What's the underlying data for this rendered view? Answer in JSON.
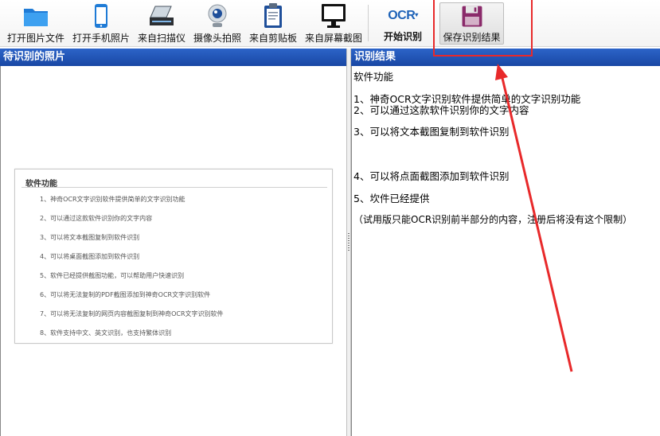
{
  "toolbar": {
    "buttons": [
      {
        "label": "打开图片文件",
        "icon": "folder-icon"
      },
      {
        "label": "打开手机照片",
        "icon": "phone-icon"
      },
      {
        "label": "来自扫描仪",
        "icon": "scanner-icon"
      },
      {
        "label": "摄像头拍照",
        "icon": "webcam-icon"
      },
      {
        "label": "来自剪贴板",
        "icon": "clipboard-icon"
      },
      {
        "label": "来自屏幕截图",
        "icon": "monitor-icon"
      }
    ],
    "ocr_logo": "OCR",
    "start_label": "开始识别",
    "save_label": "保存识别结果",
    "save_icon": "floppy-disk-icon"
  },
  "left_panel": {
    "title": "待识别的照片",
    "card": {
      "title": "软件功能",
      "items": [
        "1、神奇OCR文字识别软件提供简单的文字识别功能",
        "2、可以通过这款软件识别你的文字内容",
        "3、可以将文本截图复制到软件识别",
        "4、可以将桌面截图添加到软件识别",
        "5、软件已经提供截图功能，可以帮助用户快速识别",
        "6、可以将无法复制的PDF截图添加到神奇OCR文字识别软件",
        "7、可以将无法复制的网页内容截图复制到神奇OCR文字识别软件",
        "8、软件支持中文、英文识别，也支持繁体识别"
      ]
    }
  },
  "right_panel": {
    "title": "识别结果",
    "lines": [
      "软件功能",
      "1、神奇OCR文字识别软件提供简单的文字识别功能",
      "2、可以通过这款软件识别你的文字内容",
      "3、可以将文本截图复制到软件识别",
      "4、可以将点面截图添加到软件识别",
      "5、坎件已经提供",
      "（试用版只能OCR识别前半部分的内容，注册后将没有这个限制）"
    ]
  },
  "colors": {
    "header_bg": "#1f4fb0",
    "annotation": "#e8292a",
    "ocr_blue": "#1f63b8"
  }
}
